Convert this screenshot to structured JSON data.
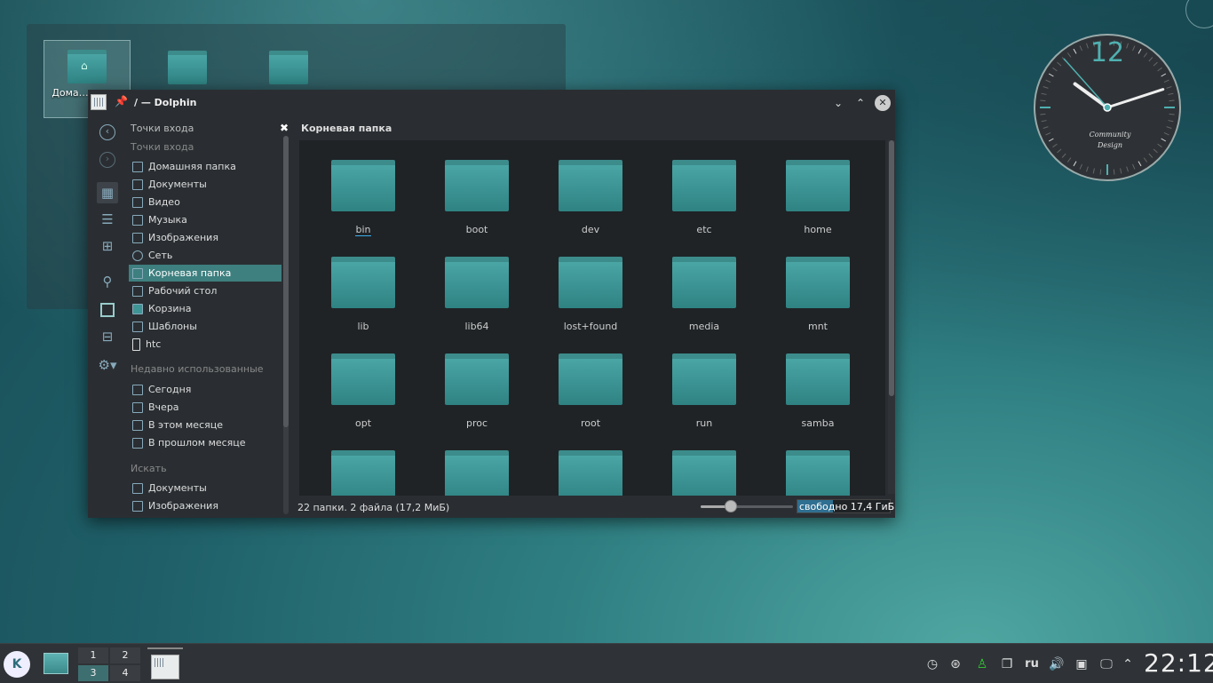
{
  "desktop": {
    "folderview": {
      "items": [
        {
          "label": "Домашняя папка",
          "label_visible": "Дома… папка"
        },
        {
          "label": ""
        },
        {
          "label": ""
        }
      ]
    },
    "clock_widget": {
      "twelve": "12",
      "brand_line1": "Community",
      "brand_line2": "Design",
      "hour": 22,
      "minute": 12
    }
  },
  "window": {
    "title": "/ — Dolphin",
    "buttons": {
      "minimize": "⌄",
      "maximize": "⌃",
      "close": "✕"
    },
    "places": {
      "header": "Точки входа",
      "sections": [
        {
          "title": "Точки входа",
          "items": [
            {
              "label": "Домашняя папка",
              "icon": "home-icon"
            },
            {
              "label": "Документы",
              "icon": "document-icon"
            },
            {
              "label": "Видео",
              "icon": "video-icon"
            },
            {
              "label": "Музыка",
              "icon": "music-icon"
            },
            {
              "label": "Изображения",
              "icon": "image-icon"
            },
            {
              "label": "Сеть",
              "icon": "network-icon"
            },
            {
              "label": "Корневая папка",
              "icon": "root-folder-icon",
              "selected": true
            },
            {
              "label": "Рабочий стол",
              "icon": "desktop-icon"
            },
            {
              "label": "Корзина",
              "icon": "trash-icon"
            },
            {
              "label": "Шаблоны",
              "icon": "templates-icon"
            },
            {
              "label": "htc",
              "icon": "phone-icon"
            }
          ]
        },
        {
          "title": "Недавно использованные",
          "items": [
            {
              "label": "Сегодня",
              "icon": "calendar-icon"
            },
            {
              "label": "Вчера",
              "icon": "calendar-icon"
            },
            {
              "label": "В этом месяце",
              "icon": "calendar-icon"
            },
            {
              "label": "В прошлом месяце",
              "icon": "calendar-icon"
            }
          ]
        },
        {
          "title": "Искать",
          "items": [
            {
              "label": "Документы",
              "icon": "folder-icon"
            },
            {
              "label": "Изображения",
              "icon": "folder-icon"
            }
          ]
        }
      ]
    },
    "breadcrumb": "Корневая папка",
    "folders": [
      "bin",
      "boot",
      "dev",
      "etc",
      "home",
      "lib",
      "lib64",
      "lost+found",
      "media",
      "mnt",
      "opt",
      "proc",
      "root",
      "run",
      "samba",
      "",
      "",
      "",
      "",
      ""
    ],
    "status": {
      "summary": "22 папки. 2 файла (17,2 МиБ)",
      "zoom_fraction": 0.33,
      "free_label": "свободно 17,4 ГиБ",
      "free_fraction": 0.38
    }
  },
  "taskbar": {
    "pager": [
      "1",
      "2",
      "3",
      "4"
    ],
    "tray_lang": "ru",
    "clock": "22:12"
  },
  "colors": {
    "accent": "#3daee9",
    "folder": "#3f9595",
    "selection": "#3e7f7f"
  }
}
